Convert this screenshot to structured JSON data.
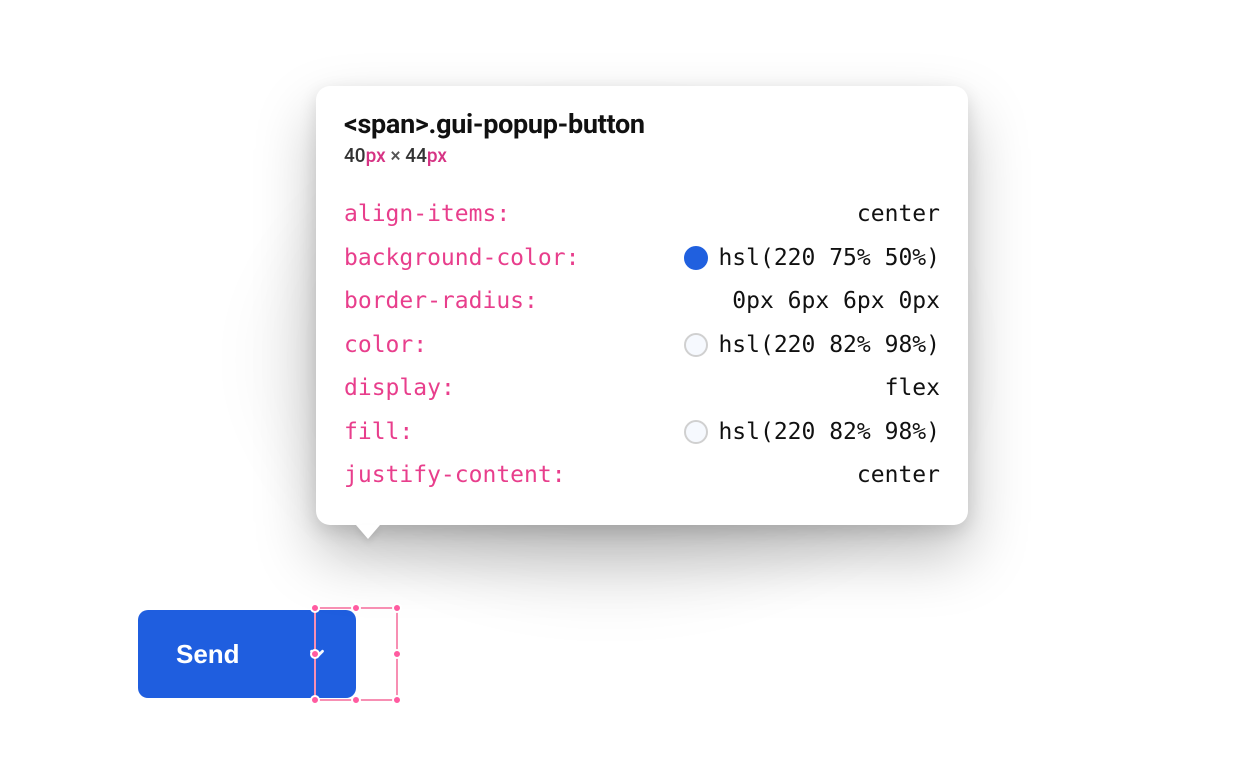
{
  "tooltip": {
    "selector": "<span>.gui-popup-button",
    "dims": {
      "w": "40",
      "wunit": "px",
      "sep": " × ",
      "h": "44",
      "hunit": "px"
    },
    "props": [
      {
        "key": "align-items",
        "value": "center",
        "swatch": null
      },
      {
        "key": "background-color",
        "value": "hsl(220 75% 50%)",
        "swatch": "#2060df"
      },
      {
        "key": "border-radius",
        "value": "0px 6px 6px 0px",
        "swatch": null
      },
      {
        "key": "color",
        "value": "hsl(220 82% 98%)",
        "swatch": "#f6f9fe"
      },
      {
        "key": "display",
        "value": "flex",
        "swatch": null
      },
      {
        "key": "fill",
        "value": "hsl(220 82% 98%)",
        "swatch": "#f6f9fe"
      },
      {
        "key": "justify-content",
        "value": "center",
        "swatch": null
      }
    ]
  },
  "button": {
    "label": "Send"
  }
}
